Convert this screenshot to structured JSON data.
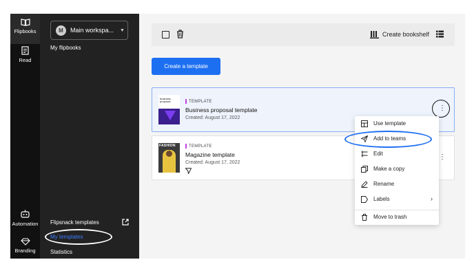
{
  "rail": {
    "flipbooks_label": "Flipbooks",
    "read_label": "Read",
    "automation_label": "Automation",
    "branding_label": "Branding"
  },
  "sidebar": {
    "workspace": {
      "initial": "M",
      "name": "Main workspa..."
    },
    "my_flipbooks": "My flipbooks",
    "flipsnack_templates": "Flipsnack templates",
    "my_templates": "My templates",
    "statistics": "Statistics"
  },
  "toolbar": {
    "create_bookshelf": "Create bookshelf"
  },
  "main": {
    "create_template_button": "Create a template"
  },
  "templates": [
    {
      "tag": "TEMPLATE",
      "title": "Business proposal template",
      "created": "Created: August 17, 2022",
      "thumb_text": "business proposal"
    },
    {
      "tag": "TEMPLATE",
      "title": "Magazine template",
      "created": "Created: August 17, 2022",
      "thumb_text": "FASHION"
    }
  ],
  "menu": {
    "items": [
      "Use template",
      "Add to teams",
      "Edit",
      "Make a copy",
      "Rename",
      "Labels",
      "Move to trash"
    ]
  },
  "colors": {
    "primary": "#1d6ff2",
    "sidebar": "#222222",
    "rail": "#111111",
    "tag_accent": "#c63fe6"
  }
}
